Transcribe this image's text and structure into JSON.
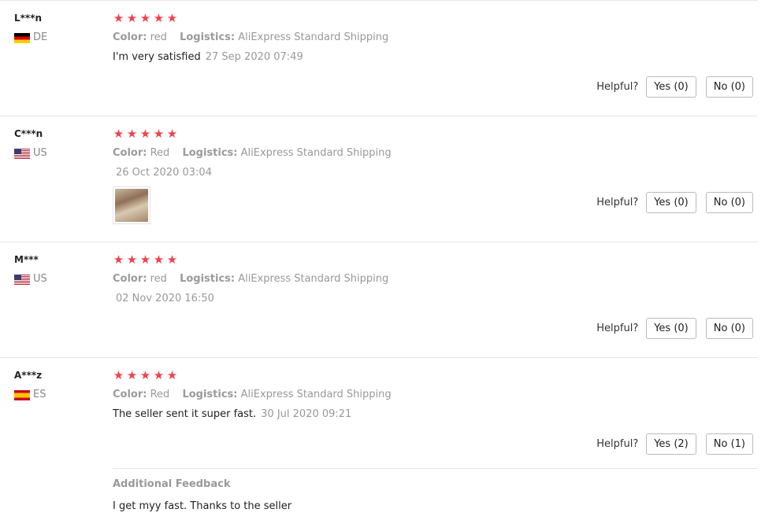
{
  "reviews": [
    {
      "user": "L***n",
      "country": "DE",
      "flag": "flag-de",
      "rating": 5,
      "color_label": "Color:",
      "color_value": "red",
      "logistics_label": "Logistics:",
      "logistics_value": "AliExpress Standard Shipping",
      "text": "I'm very satisfied",
      "date": "27 Sep 2020 07:49",
      "helpful_label": "Helpful?",
      "yes_label": "Yes (0)",
      "no_label": "No (0)"
    },
    {
      "user": "C***n",
      "country": "US",
      "flag": "flag-us",
      "rating": 5,
      "color_label": "Color:",
      "color_value": "Red",
      "logistics_label": "Logistics:",
      "logistics_value": "AliExpress Standard Shipping",
      "text": "",
      "date": "26 Oct 2020 03:04",
      "helpful_label": "Helpful?",
      "yes_label": "Yes (0)",
      "no_label": "No (0)"
    },
    {
      "user": "M***",
      "country": "US",
      "flag": "flag-us",
      "rating": 5,
      "color_label": "Color:",
      "color_value": "red",
      "logistics_label": "Logistics:",
      "logistics_value": "AliExpress Standard Shipping",
      "text": "",
      "date": "02 Nov 2020 16:50",
      "helpful_label": "Helpful?",
      "yes_label": "Yes (0)",
      "no_label": "No (0)"
    },
    {
      "user": "A***z",
      "country": "ES",
      "flag": "flag-es",
      "rating": 5,
      "color_label": "Color:",
      "color_value": "Red",
      "logistics_label": "Logistics:",
      "logistics_value": "AliExpress Standard Shipping",
      "text": "The seller sent it super fast.",
      "date": "30 Jul 2020 09:21",
      "helpful_label": "Helpful?",
      "yes_label": "Yes (2)",
      "no_label": "No (1)"
    }
  ],
  "additional_feedback": {
    "title": "Additional Feedback",
    "text": "I get myy fast. Thanks to the seller"
  },
  "colors": {
    "star": "#f0424d",
    "muted_text": "#999999",
    "border": "#e6e6e6"
  },
  "icons": {
    "star": "star-icon",
    "flag": "country-flag-icon"
  }
}
